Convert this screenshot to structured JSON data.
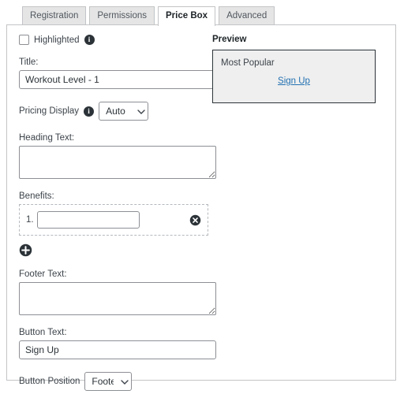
{
  "tabs": [
    {
      "label": "Registration",
      "active": false
    },
    {
      "label": "Permissions",
      "active": false
    },
    {
      "label": "Price Box",
      "active": true
    },
    {
      "label": "Advanced",
      "active": false
    }
  ],
  "form": {
    "highlighted": {
      "label": "Highlighted",
      "checked": false,
      "info_icon": "info-icon"
    },
    "title": {
      "label": "Title:",
      "value": "Workout Level - 1",
      "placeholder": ""
    },
    "pricing_display": {
      "label": "Pricing Display",
      "info_icon": "info-icon",
      "value": "Auto",
      "options": [
        "Auto"
      ]
    },
    "heading_text": {
      "label": "Heading Text:",
      "value": "",
      "placeholder": ""
    },
    "benefits": {
      "label": "Benefits:",
      "items": [
        {
          "number": "1.",
          "value": "",
          "placeholder": "",
          "remove_icon": "remove-circle-icon"
        }
      ],
      "add_icon": "add-circle-icon"
    },
    "footer_text": {
      "label": "Footer Text:",
      "value": "",
      "placeholder": ""
    },
    "button_text": {
      "label": "Button Text:",
      "value": "Sign Up",
      "placeholder": ""
    },
    "button_position": {
      "label": "Button Position",
      "value": "Footer",
      "options": [
        "Footer"
      ]
    }
  },
  "preview": {
    "title": "Preview",
    "heading": "Most Popular",
    "link_label": "Sign Up"
  },
  "colors": {
    "accent_link": "#2271b1",
    "tab_inactive_bg": "#e5e5e5",
    "tab_active_bg": "#ffffff",
    "panel_border": "#c3c4c7",
    "input_border": "#8c8f94",
    "preview_bg": "#efefef",
    "preview_border": "#2c3338",
    "icon_dark": "#2c3338"
  }
}
